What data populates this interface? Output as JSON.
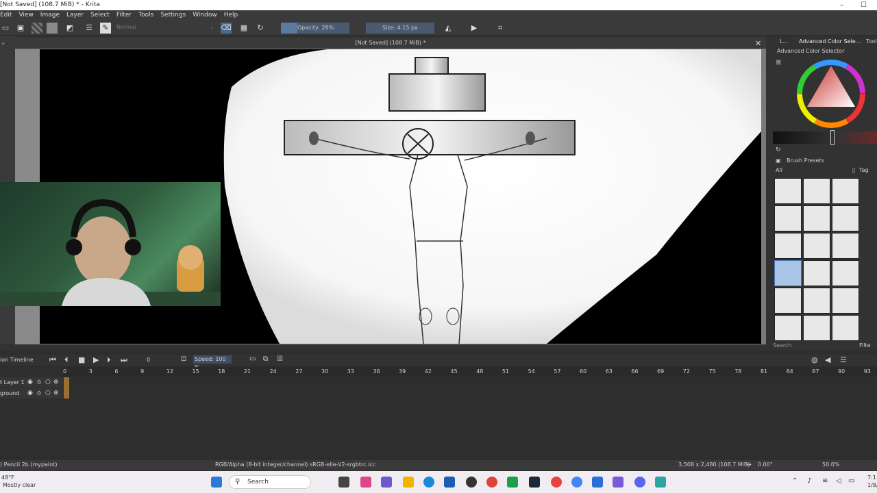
{
  "window": {
    "title": "[Not Saved] (108.7 MiB) * - Krita",
    "controls": [
      "–",
      "☐"
    ]
  },
  "menubar": [
    "Edit",
    "View",
    "Image",
    "Layer",
    "Select",
    "Filter",
    "Tools",
    "Settings",
    "Window",
    "Help"
  ],
  "toolbar": {
    "blend_mode": "Normal",
    "opacity": "Opacity: 28%",
    "size": "Size: 4.15 px"
  },
  "canvas": {
    "title": "[Not Saved]  (108.7 MiB) *"
  },
  "dock": {
    "tab_short": "L...",
    "tab_color": "Advanced Color Sele...",
    "tab_tools": "Tool",
    "color_selector_title": "Advanced Color Selector",
    "brush_presets_title": "Brush Presets",
    "filter_all": "All",
    "tag_label": "Tag",
    "search_placeholder": "Search",
    "filter_label": "Filte"
  },
  "timeline": {
    "title": "ion Timeline",
    "frame": "0",
    "speed": "Speed: 100 %",
    "ruler": [
      "0",
      "3",
      "6",
      "9",
      "12",
      "15",
      "18",
      "21",
      "24",
      "27",
      "30",
      "33",
      "36",
      "39",
      "42",
      "45",
      "48",
      "51",
      "54",
      "57",
      "60",
      "63",
      "66",
      "69",
      "72",
      "75",
      "78",
      "81",
      "84",
      "87",
      "90",
      "93"
    ],
    "layers": [
      "t Layer 1",
      "ground"
    ]
  },
  "status": {
    "brush": ") Pencil 2b (mypaint)",
    "colorspace": "RGB/Alpha (8-bit integer/channel)  sRGB-elle-V2-srgbtrc.icc",
    "dimensions": "3,508 x 2,480 (108.7 MiB)",
    "rotation": "0.00°",
    "zoom": "50.0%"
  },
  "taskbar": {
    "weather_temp": "48°F",
    "weather_desc": "Mostly clear",
    "search": "Search",
    "time": "7:1",
    "date": "1/8/"
  },
  "colors": {
    "accent": "#4a7ab0",
    "panel": "#323232",
    "toolbar": "#3a3a3a"
  }
}
